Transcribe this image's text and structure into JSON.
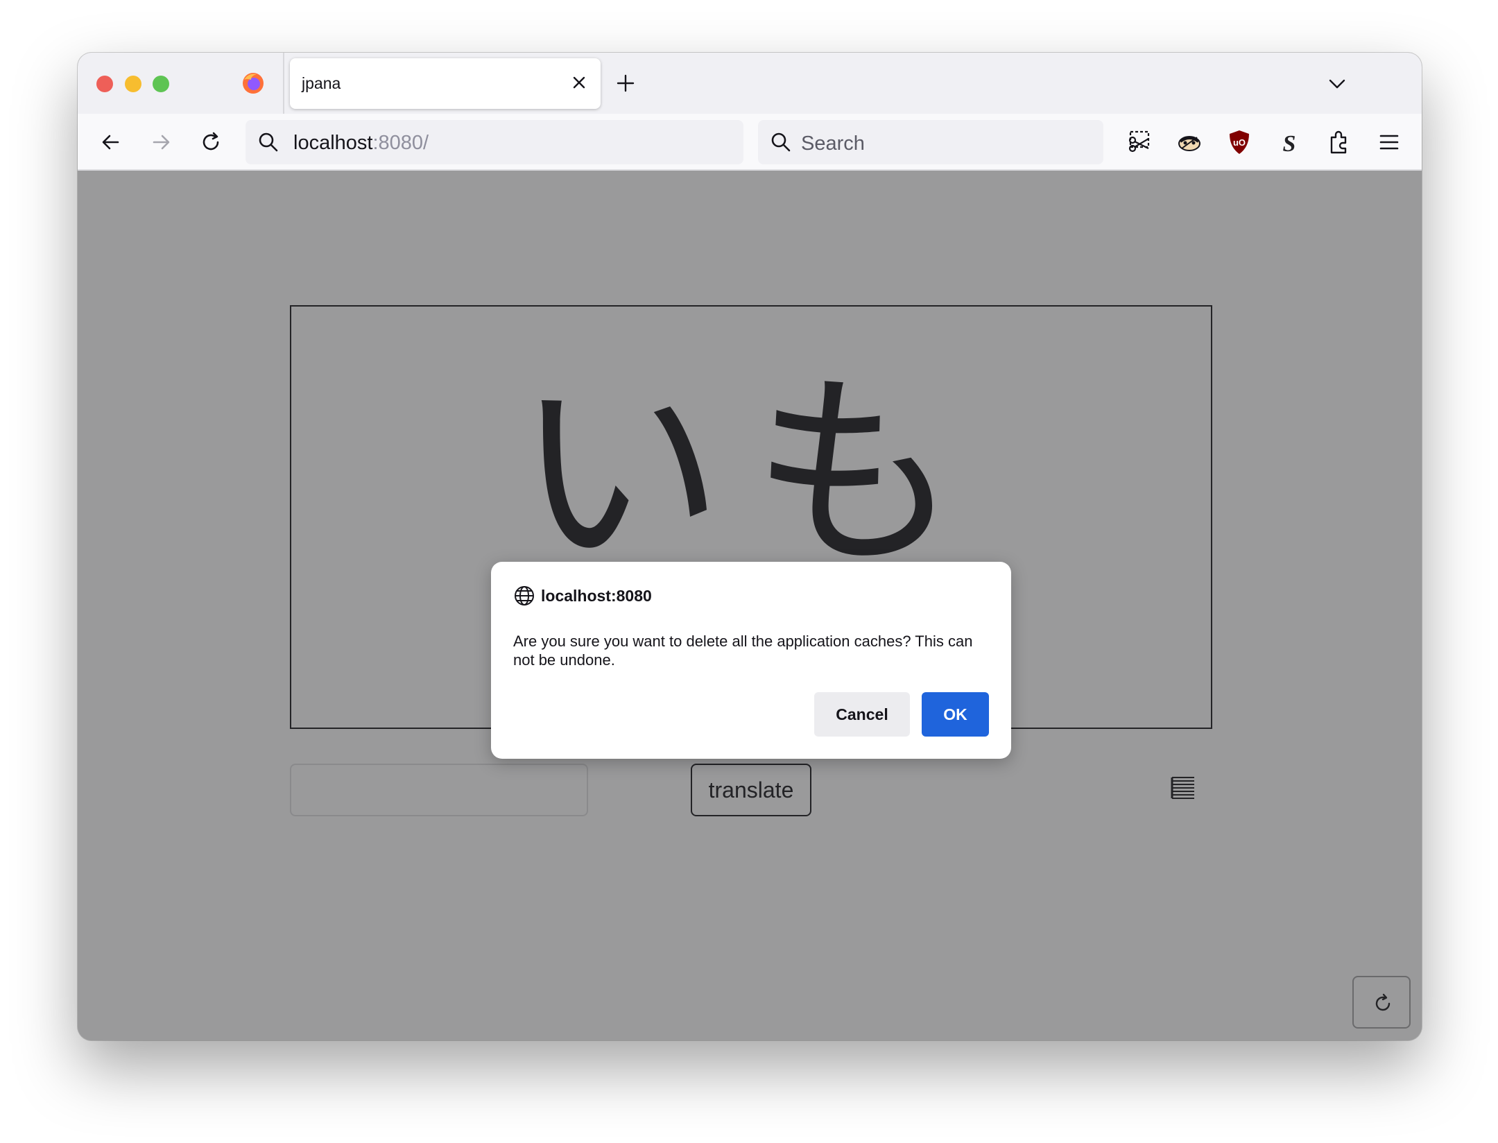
{
  "tab": {
    "title": "jpana"
  },
  "address": {
    "host": "localhost",
    "rest": ":8080/"
  },
  "search": {
    "placeholder": "Search"
  },
  "page": {
    "kana": "いも",
    "translate_label": "translate"
  },
  "dialog": {
    "origin": "localhost:8080",
    "message": "Are you sure you want to delete all the application caches? This can not be undone.",
    "cancel_label": "Cancel",
    "ok_label": "OK"
  },
  "colors": {
    "accent": "#1f64dc",
    "page_bg": "#9a9a9b",
    "ublock": "#800000"
  },
  "icons": [
    "firefox-icon",
    "close-icon",
    "plus-icon",
    "chevron-down-icon",
    "back-arrow-icon",
    "forward-arrow-icon",
    "reload-icon",
    "search-icon",
    "screenshot-icon",
    "extension-raccoon-icon",
    "ublock-origin-icon",
    "stylus-s-icon",
    "extensions-puzzle-icon",
    "hamburger-menu-icon",
    "globe-icon",
    "list-icon",
    "refresh-icon"
  ]
}
